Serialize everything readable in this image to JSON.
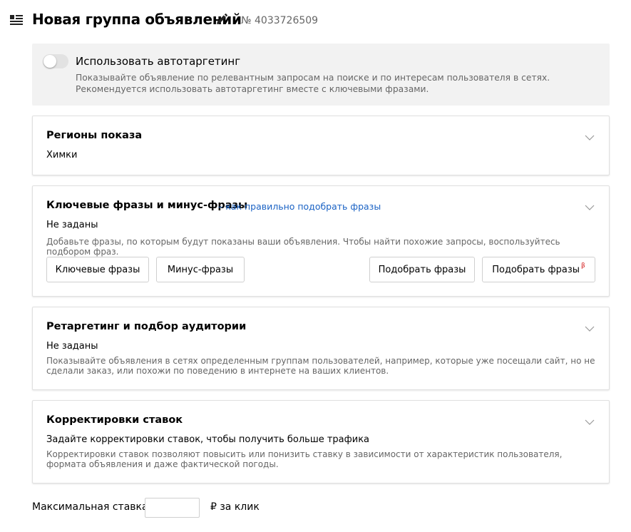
{
  "header": {
    "title": "Новая группа объявлений",
    "number": "№ 4033726509"
  },
  "autotargeting": {
    "label": "Использовать автотаргетинг",
    "enabled": false,
    "description": "Показывайте объявление по релевантным запросам на поиске и по интересам пользователя в сетях. Рекомендуется использовать автотаргетинг вместе с ключевыми фразами."
  },
  "regions": {
    "title": "Регионы показа",
    "value": "Химки"
  },
  "keywords": {
    "title": "Ключевые фразы и минус-фразы",
    "help_link": "– как правильно подобрать фразы",
    "value": "Не заданы",
    "description": "Добавьте фразы, по которым будут показаны ваши объявления. Чтобы найти похожие запросы, воспользуйтесь подбором фраз.",
    "buttons": {
      "keywords": "Ключевые фразы",
      "minus": "Минус-фразы",
      "pick": "Подобрать фразы",
      "pick_beta": "Подобрать фразы",
      "beta_mark": "β"
    }
  },
  "retargeting": {
    "title": "Ретаргетинг и подбор аудитории",
    "value": "Не заданы",
    "description": "Показывайте объявления в сетях определенным группам пользователей, например, которые уже посещали сайт, но не сделали заказ, или похожи по поведению в интернете на ваших клиентов."
  },
  "bid_adjustments": {
    "title": "Корректировки ставок",
    "value": "Задайте корректировки ставок, чтобы получить больше трафика",
    "description": "Корректировки ставок позволяют повысить или понизить ставку в зависимости от характеристик пользователя, формата объявления и даже фактической погоды."
  },
  "max_bid": {
    "label": "Максимальная ставка",
    "value": "",
    "unit": "₽ за клик"
  },
  "icons": {
    "menu": "list-menu-icon",
    "edit": "pencil-icon",
    "chevron": "chevron-down-icon"
  }
}
